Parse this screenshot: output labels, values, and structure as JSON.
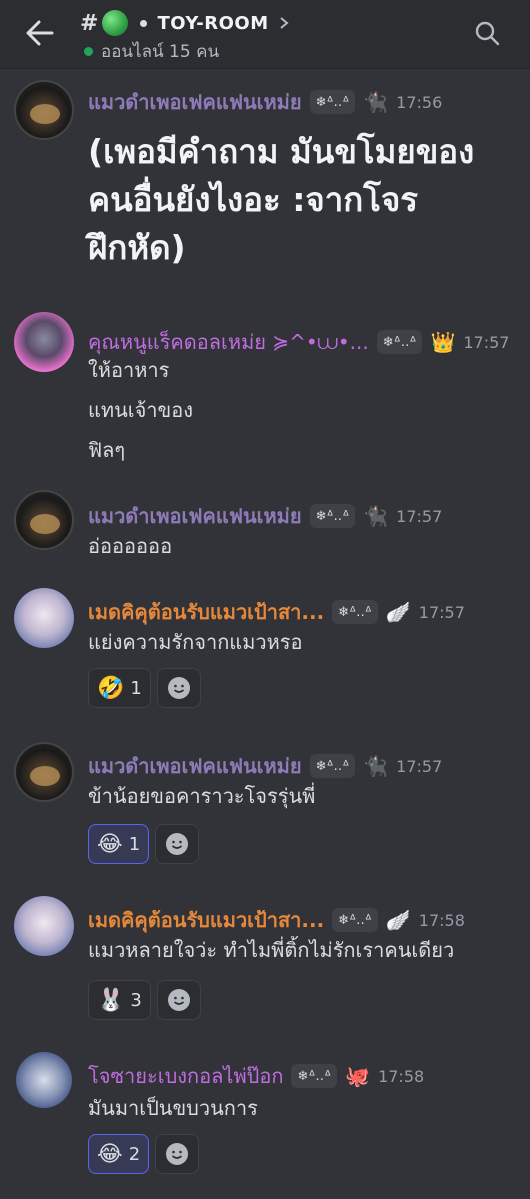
{
  "header": {
    "channel_prefix": "#",
    "channel_name": "TOY-ROOM",
    "online_text": "ออนไลน์ 15 คน"
  },
  "messages": [
    {
      "author": "แมวดำเพอเฟคแฟนเหม่ย",
      "tag": "❄ᐞ‥ᐞ",
      "badge": "🐈‍⬛",
      "time": "17:56",
      "lines": [
        "(เพอมีคำถาม มันขโมยของคนอื่นยังไงอะ :จากโจรฝึกหัด)"
      ],
      "reactions": []
    },
    {
      "author": "คุณหนูแร็คดอลเหม่ย ≽^•⩊•...",
      "tag": "❄ᐞ‥ᐞ",
      "badge": "👑",
      "time": "17:57",
      "lines": [
        "ให้อาหาร",
        "แทนเจ้าของ",
        "ฟิลๆ"
      ],
      "reactions": []
    },
    {
      "author": "แมวดำเพอเฟคแฟนเหม่ย",
      "tag": "❄ᐞ‥ᐞ",
      "badge": "🐈‍⬛",
      "time": "17:57",
      "lines": [
        "อ่ออออออ"
      ],
      "reactions": []
    },
    {
      "author": "เมดคิคุต้อนรับแมวเป้าสา...",
      "tag": "❄ᐞ‥ᐞ",
      "badge": "🪽",
      "time": "17:57",
      "lines": [
        "แย่งความรักจากแมวหรอ"
      ],
      "reactions": [
        {
          "emoji": "🤣",
          "count": "1",
          "active": false
        }
      ]
    },
    {
      "author": "แมวดำเพอเฟคแฟนเหม่ย",
      "tag": "❄ᐞ‥ᐞ",
      "badge": "🐈‍⬛",
      "time": "17:57",
      "lines": [
        "ข้าน้อยขอคาราวะโจรรุ่นพี่"
      ],
      "reactions": [
        {
          "emoji": "😂",
          "count": "1",
          "active": true
        }
      ]
    },
    {
      "author": "เมดคิคุต้อนรับแมวเป้าสา...",
      "tag": "❄ᐞ‥ᐞ",
      "badge": "🪽",
      "time": "17:58",
      "lines": [
        "แมวหลายใจว่ะ ทำไมพี่ติ้กไม่รักเราคนเดียว"
      ],
      "reactions": [
        {
          "emoji": "🐰",
          "count": "3",
          "active": false
        }
      ]
    },
    {
      "author": "โจซายะเบงกอลไพ่ป๊อก",
      "tag": "❄ᐞ‥ᐞ",
      "badge": "🐙",
      "time": "17:58",
      "lines": [
        "มันมาเป็นขบวนการ"
      ],
      "reactions": [
        {
          "emoji": "😂",
          "count": "2",
          "active": true
        }
      ]
    }
  ]
}
